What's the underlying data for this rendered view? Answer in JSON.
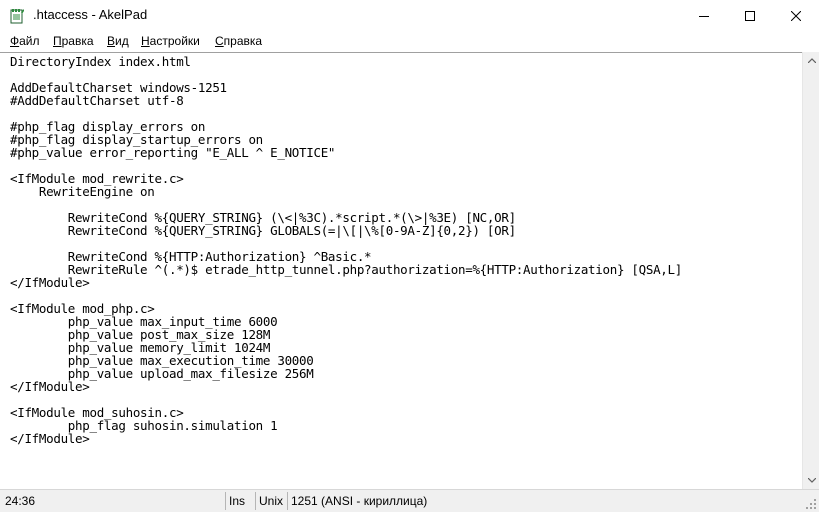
{
  "window": {
    "title": ".htaccess - AkelPad",
    "app_icon": "notepad-icon",
    "controls": [
      "minimize-icon",
      "maximize-icon",
      "close-icon"
    ]
  },
  "menu": {
    "file": {
      "accel": "Ф",
      "rest": "айл"
    },
    "edit": {
      "accel": "П",
      "rest": "равка"
    },
    "view": {
      "accel": "В",
      "rest": "ид"
    },
    "settings": {
      "accel": "Н",
      "rest": "астройки"
    },
    "help": {
      "accel": "С",
      "rest": "правка"
    }
  },
  "editor": {
    "content": "DirectoryIndex index.html\n\nAddDefaultCharset windows-1251\n#AddDefaultCharset utf-8\n\n#php_flag display_errors on\n#php_flag display_startup_errors on\n#php_value error_reporting \"E_ALL ^ E_NOTICE\"\n\n<IfModule mod_rewrite.c>\n    RewriteEngine on\n\n        RewriteCond %{QUERY_STRING} (\\<|%3C).*script.*(\\>|%3E) [NC,OR]\n        RewriteCond %{QUERY_STRING} GLOBALS(=|\\[|\\%[0-9A-Z]{0,2}) [OR]\n\n        RewriteCond %{HTTP:Authorization} ^Basic.*\n        RewriteRule ^(.*)$ etrade_http_tunnel.php?authorization=%{HTTP:Authorization} [QSA,L]\n</IfModule>\n\n<IfModule mod_php.c>\n        php_value max_input_time 6000\n        php_value post_max_size 128M\n        php_value memory_limit 1024M\n        php_value max_execution_time 30000\n        php_value upload_max_filesize 256M\n</IfModule>\n\n<IfModule mod_suhosin.c>\n        php_flag suhosin.simulation 1\n</IfModule>"
  },
  "status": {
    "position": "24:36",
    "insert_mode": "Ins",
    "line_endings": "Unix",
    "encoding": "1251  (ANSI - кириллица)"
  }
}
